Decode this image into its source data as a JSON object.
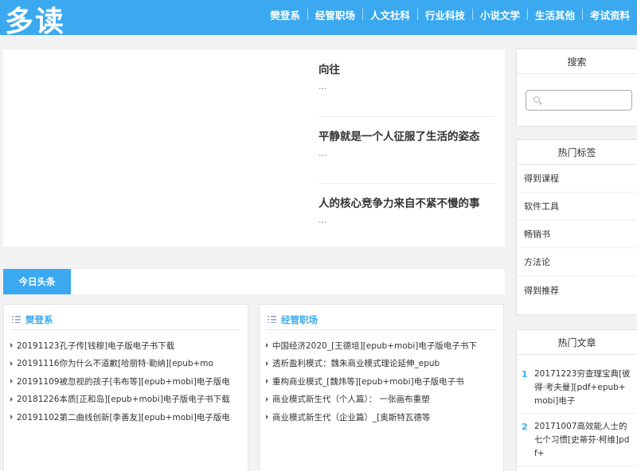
{
  "header": {
    "logo": "多读",
    "nav": [
      "樊登系",
      "经管职场",
      "人文社科",
      "行业科技",
      "小说文学",
      "生活其他",
      "考试资料"
    ]
  },
  "featured": [
    {
      "title": "向往",
      "summary": "..."
    },
    {
      "title": "平静就是一个人征服了生活的姿态",
      "summary": "..."
    },
    {
      "title": "人的核心竞争力来自不紧不慢的事",
      "summary": "..."
    }
  ],
  "tabs": {
    "active": "今日头条"
  },
  "boxes": [
    {
      "title": "樊登系",
      "items": [
        "20191123孔子传[钱穆]电子版电子书下载",
        "20191116你为什么不道歉[哈丽特·勒纳][epub+mo",
        "20191109被忽视的孩子[韦布等][epub+mobi]电子版电",
        "20181226本质[正和岛][epub+mobi]电子版电子书下载",
        "20191102第二曲线创新[李善友][epub+mobi]电子版电"
      ]
    },
    {
      "title": "经管职场",
      "items": [
        "中国经济2020_[王德培][epub+mobi]电子版电子书下",
        "透析盈利模式：魏朱商业模式理论延伸_epub",
        "重构商业模式_[魏炜等][epub+mobi]电子版电子书",
        "商业模式新生代（个人篇）： 一张画布重塑",
        "商业模式新生代（企业篇）_[奥斯特瓦德等"
      ]
    }
  ],
  "sidebar": {
    "search": {
      "title": "搜索",
      "placeholder": ""
    },
    "tags": {
      "title": "热门标签",
      "items": [
        "得到课程",
        "软件工具",
        "畅销书",
        "方法论",
        "得到推荐"
      ]
    },
    "articles": {
      "title": "热门文章",
      "items": [
        {
          "num": "1",
          "text": "20171223穷查理宝典[彼得·考夫曼][pdf+epub+mobi]电子"
        },
        {
          "num": "2",
          "text": "20171007高效能人士的七个习惯[史蒂芬·柯维]pdf+"
        }
      ]
    }
  },
  "colors": {
    "accent": "#3aa9f0",
    "background": "#f2f2f2"
  }
}
